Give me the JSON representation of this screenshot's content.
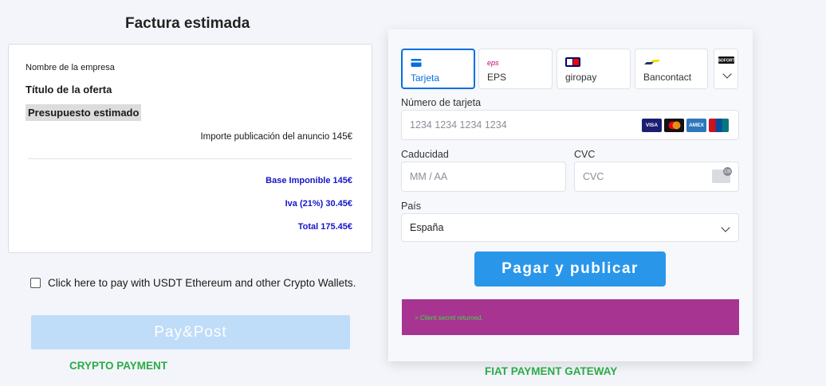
{
  "invoice": {
    "title": "Factura estimada",
    "company": "Nombre de la empresa",
    "offer_title": "Título de la oferta",
    "budget_label": "Presupuesto estimado",
    "ad_import": "Importe publicación del anuncio 145€",
    "base": "Base Imponible 145€",
    "iva": "Iva (21%) 30.45€",
    "total": "Total 175.45€"
  },
  "crypto": {
    "checkbox_label": "Click here to pay with USDT Ethereum and other Crypto Wallets.",
    "checked": false,
    "button_label": "Pay&Post",
    "section_label": "CRYPTO PAYMENT"
  },
  "payment": {
    "methods": [
      {
        "label": "Tarjeta",
        "icon": "card-icon",
        "active": true
      },
      {
        "label": "EPS",
        "icon": "eps-icon",
        "active": false
      },
      {
        "label": "giropay",
        "icon": "giropay-icon",
        "active": false
      },
      {
        "label": "Bancontact",
        "icon": "bancontact-icon",
        "active": false
      },
      {
        "label": "SOFORT",
        "icon": "sofort-icon",
        "active": false
      }
    ],
    "card_number_label": "Número de tarjeta",
    "card_number_placeholder": "1234 1234 1234 1234",
    "card_brands": [
      "VISA",
      "Mastercard",
      "AMEX",
      "UnionPay"
    ],
    "expiry_label": "Caducidad",
    "expiry_placeholder": "MM / AA",
    "cvc_label": "CVC",
    "cvc_placeholder": "CVC",
    "cvc_badge": "135",
    "country_label": "País",
    "country_value": "España",
    "pay_button": "Pagar y publicar",
    "console_message": "> Client secret returned.",
    "section_label": "FIAT PAYMENT GATEWAY"
  },
  "colors": {
    "accent": "#0570de",
    "pay_button": "#2a96ea",
    "pay_disabled": "#bfdcf8",
    "highlight_text": "#1515c8",
    "green_label": "#2bab46",
    "console_bg": "#a83491",
    "console_text": "#41d941"
  }
}
